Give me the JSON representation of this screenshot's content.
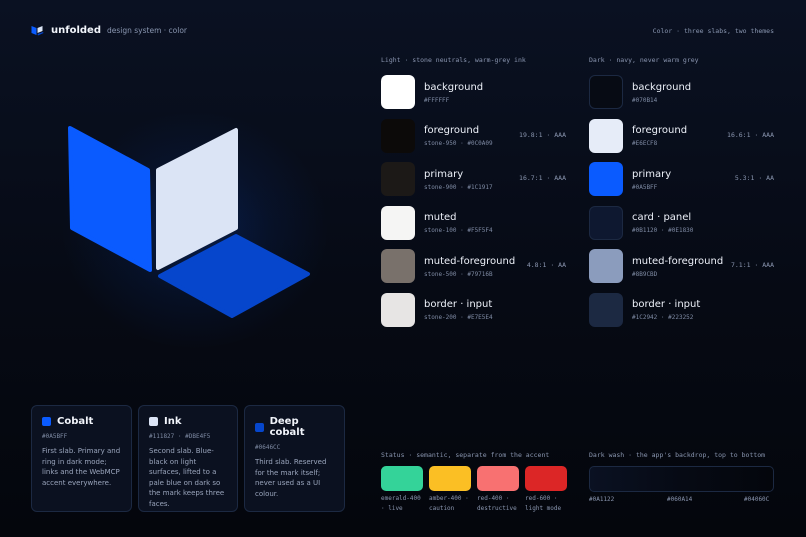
{
  "header": {
    "brand_name": "unfolded",
    "brand_sub": "design system · color",
    "top_right": "Color · three slabs, two themes"
  },
  "light": {
    "title": "Light · stone neutrals, warm-grey ink",
    "rows": [
      {
        "name": "background",
        "code": "#FFFFFF",
        "ratio": "",
        "color": "#FFFFFF"
      },
      {
        "name": "foreground",
        "code": "stone-950 · #0C0A09",
        "ratio": "19.8:1 · AAA",
        "color": "#0C0A09"
      },
      {
        "name": "primary",
        "code": "stone-900 · #1C1917",
        "ratio": "16.7:1 · AAA",
        "color": "#1C1917"
      },
      {
        "name": "muted",
        "code": "stone-100 · #F5F5F4",
        "ratio": "",
        "color": "#F5F5F4"
      },
      {
        "name": "muted-foreground",
        "code": "stone-500 · #79716B",
        "ratio": "4.8:1 · AA",
        "color": "#79716B"
      },
      {
        "name": "border · input",
        "code": "stone-200 · #E7E5E4",
        "ratio": "",
        "color": "#E7E5E4"
      }
    ]
  },
  "dark": {
    "title": "Dark · navy, never warm grey",
    "rows": [
      {
        "name": "background",
        "code": "#070B14",
        "ratio": "",
        "color": "#070B14"
      },
      {
        "name": "foreground",
        "code": "#E6ECF8",
        "ratio": "16.6:1 · AAA",
        "color": "#E6ECF8"
      },
      {
        "name": "primary",
        "code": "#0A5BFF",
        "ratio": "5.3:1 · AA",
        "color": "#0A5BFF"
      },
      {
        "name": "card · panel",
        "code": "#0B1120 · #0E1830",
        "ratio": "",
        "color": "#0E1830"
      },
      {
        "name": "muted-foreground",
        "code": "#8B9CBD",
        "ratio": "7.1:1 · AAA",
        "color": "#8B9CBD"
      },
      {
        "name": "border · input",
        "code": "#1C2942 · #223252",
        "ratio": "",
        "color": "#1C2942"
      }
    ]
  },
  "cards": [
    {
      "name": "Cobalt",
      "code": "#0A5BFF",
      "color": "#0A5BFF",
      "desc": "First slab. Primary and ring in dark mode; links and the WebMCP accent everywhere."
    },
    {
      "name": "Ink",
      "code": "#111827 · #DBE4F5",
      "color": "#DBE4F5",
      "desc": "Second slab. Blue-black on light surfaces, lifted to a pale blue on dark so the mark keeps three faces."
    },
    {
      "name": "Deep cobalt",
      "code": "#0646CC",
      "color": "#0646CC",
      "desc": "Third slab. Reserved for the mark itself; never used as a UI colour."
    }
  ],
  "status": {
    "title": "Status · semantic, separate from the accent",
    "items": [
      {
        "label": "emerald-400 · live",
        "color": "#34D399"
      },
      {
        "label": "amber-400 · caution",
        "color": "#FBBF24"
      },
      {
        "label": "red-400 · destructive",
        "color": "#F87171"
      },
      {
        "label": "red-600 · light mode",
        "color": "#DC2626"
      }
    ]
  },
  "wash": {
    "title": "Dark wash · the app's backdrop, top to bottom",
    "stops": [
      "#0A1122",
      "#060A14",
      "#04060C"
    ]
  }
}
